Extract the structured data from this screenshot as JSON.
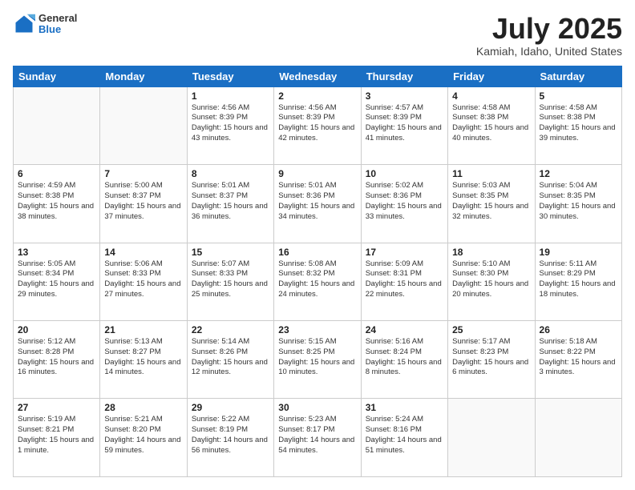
{
  "header": {
    "logo_general": "General",
    "logo_blue": "Blue",
    "month_title": "July 2025",
    "location": "Kamiah, Idaho, United States"
  },
  "days_of_week": [
    "Sunday",
    "Monday",
    "Tuesday",
    "Wednesday",
    "Thursday",
    "Friday",
    "Saturday"
  ],
  "weeks": [
    [
      {
        "day": "",
        "sunrise": "",
        "sunset": "",
        "daylight": ""
      },
      {
        "day": "",
        "sunrise": "",
        "sunset": "",
        "daylight": ""
      },
      {
        "day": "1",
        "sunrise": "Sunrise: 4:56 AM",
        "sunset": "Sunset: 8:39 PM",
        "daylight": "Daylight: 15 hours and 43 minutes."
      },
      {
        "day": "2",
        "sunrise": "Sunrise: 4:56 AM",
        "sunset": "Sunset: 8:39 PM",
        "daylight": "Daylight: 15 hours and 42 minutes."
      },
      {
        "day": "3",
        "sunrise": "Sunrise: 4:57 AM",
        "sunset": "Sunset: 8:39 PM",
        "daylight": "Daylight: 15 hours and 41 minutes."
      },
      {
        "day": "4",
        "sunrise": "Sunrise: 4:58 AM",
        "sunset": "Sunset: 8:38 PM",
        "daylight": "Daylight: 15 hours and 40 minutes."
      },
      {
        "day": "5",
        "sunrise": "Sunrise: 4:58 AM",
        "sunset": "Sunset: 8:38 PM",
        "daylight": "Daylight: 15 hours and 39 minutes."
      }
    ],
    [
      {
        "day": "6",
        "sunrise": "Sunrise: 4:59 AM",
        "sunset": "Sunset: 8:38 PM",
        "daylight": "Daylight: 15 hours and 38 minutes."
      },
      {
        "day": "7",
        "sunrise": "Sunrise: 5:00 AM",
        "sunset": "Sunset: 8:37 PM",
        "daylight": "Daylight: 15 hours and 37 minutes."
      },
      {
        "day": "8",
        "sunrise": "Sunrise: 5:01 AM",
        "sunset": "Sunset: 8:37 PM",
        "daylight": "Daylight: 15 hours and 36 minutes."
      },
      {
        "day": "9",
        "sunrise": "Sunrise: 5:01 AM",
        "sunset": "Sunset: 8:36 PM",
        "daylight": "Daylight: 15 hours and 34 minutes."
      },
      {
        "day": "10",
        "sunrise": "Sunrise: 5:02 AM",
        "sunset": "Sunset: 8:36 PM",
        "daylight": "Daylight: 15 hours and 33 minutes."
      },
      {
        "day": "11",
        "sunrise": "Sunrise: 5:03 AM",
        "sunset": "Sunset: 8:35 PM",
        "daylight": "Daylight: 15 hours and 32 minutes."
      },
      {
        "day": "12",
        "sunrise": "Sunrise: 5:04 AM",
        "sunset": "Sunset: 8:35 PM",
        "daylight": "Daylight: 15 hours and 30 minutes."
      }
    ],
    [
      {
        "day": "13",
        "sunrise": "Sunrise: 5:05 AM",
        "sunset": "Sunset: 8:34 PM",
        "daylight": "Daylight: 15 hours and 29 minutes."
      },
      {
        "day": "14",
        "sunrise": "Sunrise: 5:06 AM",
        "sunset": "Sunset: 8:33 PM",
        "daylight": "Daylight: 15 hours and 27 minutes."
      },
      {
        "day": "15",
        "sunrise": "Sunrise: 5:07 AM",
        "sunset": "Sunset: 8:33 PM",
        "daylight": "Daylight: 15 hours and 25 minutes."
      },
      {
        "day": "16",
        "sunrise": "Sunrise: 5:08 AM",
        "sunset": "Sunset: 8:32 PM",
        "daylight": "Daylight: 15 hours and 24 minutes."
      },
      {
        "day": "17",
        "sunrise": "Sunrise: 5:09 AM",
        "sunset": "Sunset: 8:31 PM",
        "daylight": "Daylight: 15 hours and 22 minutes."
      },
      {
        "day": "18",
        "sunrise": "Sunrise: 5:10 AM",
        "sunset": "Sunset: 8:30 PM",
        "daylight": "Daylight: 15 hours and 20 minutes."
      },
      {
        "day": "19",
        "sunrise": "Sunrise: 5:11 AM",
        "sunset": "Sunset: 8:29 PM",
        "daylight": "Daylight: 15 hours and 18 minutes."
      }
    ],
    [
      {
        "day": "20",
        "sunrise": "Sunrise: 5:12 AM",
        "sunset": "Sunset: 8:28 PM",
        "daylight": "Daylight: 15 hours and 16 minutes."
      },
      {
        "day": "21",
        "sunrise": "Sunrise: 5:13 AM",
        "sunset": "Sunset: 8:27 PM",
        "daylight": "Daylight: 15 hours and 14 minutes."
      },
      {
        "day": "22",
        "sunrise": "Sunrise: 5:14 AM",
        "sunset": "Sunset: 8:26 PM",
        "daylight": "Daylight: 15 hours and 12 minutes."
      },
      {
        "day": "23",
        "sunrise": "Sunrise: 5:15 AM",
        "sunset": "Sunset: 8:25 PM",
        "daylight": "Daylight: 15 hours and 10 minutes."
      },
      {
        "day": "24",
        "sunrise": "Sunrise: 5:16 AM",
        "sunset": "Sunset: 8:24 PM",
        "daylight": "Daylight: 15 hours and 8 minutes."
      },
      {
        "day": "25",
        "sunrise": "Sunrise: 5:17 AM",
        "sunset": "Sunset: 8:23 PM",
        "daylight": "Daylight: 15 hours and 6 minutes."
      },
      {
        "day": "26",
        "sunrise": "Sunrise: 5:18 AM",
        "sunset": "Sunset: 8:22 PM",
        "daylight": "Daylight: 15 hours and 3 minutes."
      }
    ],
    [
      {
        "day": "27",
        "sunrise": "Sunrise: 5:19 AM",
        "sunset": "Sunset: 8:21 PM",
        "daylight": "Daylight: 15 hours and 1 minute."
      },
      {
        "day": "28",
        "sunrise": "Sunrise: 5:21 AM",
        "sunset": "Sunset: 8:20 PM",
        "daylight": "Daylight: 14 hours and 59 minutes."
      },
      {
        "day": "29",
        "sunrise": "Sunrise: 5:22 AM",
        "sunset": "Sunset: 8:19 PM",
        "daylight": "Daylight: 14 hours and 56 minutes."
      },
      {
        "day": "30",
        "sunrise": "Sunrise: 5:23 AM",
        "sunset": "Sunset: 8:17 PM",
        "daylight": "Daylight: 14 hours and 54 minutes."
      },
      {
        "day": "31",
        "sunrise": "Sunrise: 5:24 AM",
        "sunset": "Sunset: 8:16 PM",
        "daylight": "Daylight: 14 hours and 51 minutes."
      },
      {
        "day": "",
        "sunrise": "",
        "sunset": "",
        "daylight": ""
      },
      {
        "day": "",
        "sunrise": "",
        "sunset": "",
        "daylight": ""
      }
    ]
  ]
}
